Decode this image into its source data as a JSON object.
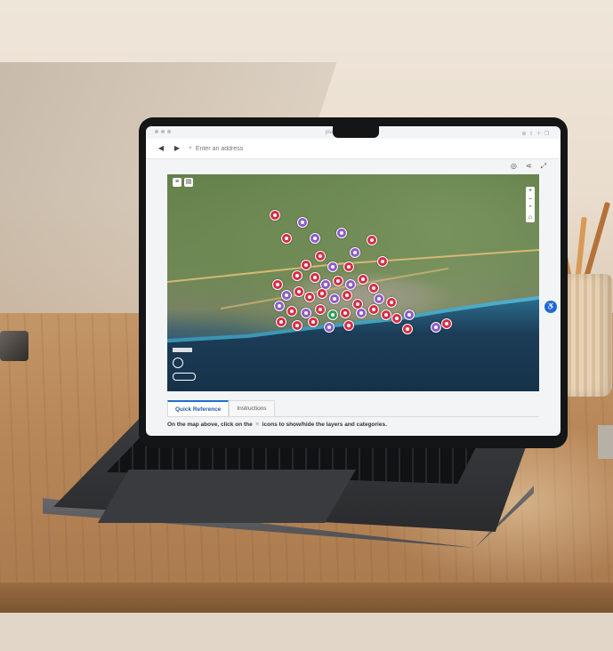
{
  "browser": {
    "url": "planyourtoronto.ca",
    "search_placeholder": "Enter an address"
  },
  "tabs": [
    {
      "label": "Quick Reference",
      "active": true
    },
    {
      "label": "Instructions",
      "active": false
    }
  ],
  "instructions": {
    "prefix": "On the map above, click on the",
    "suffix": "icons to show/hide the layers and categories."
  },
  "map": {
    "marker_colors": {
      "red": "#d62e45",
      "purple": "#8e5cc9",
      "green": "#2f9e58"
    },
    "icons": [
      "layers-icon",
      "list-icon",
      "zoom-in-icon",
      "zoom-out-icon",
      "compass-icon",
      "home-icon",
      "locate-icon",
      "share-icon",
      "fullscreen-icon",
      "accessibility-icon"
    ]
  }
}
